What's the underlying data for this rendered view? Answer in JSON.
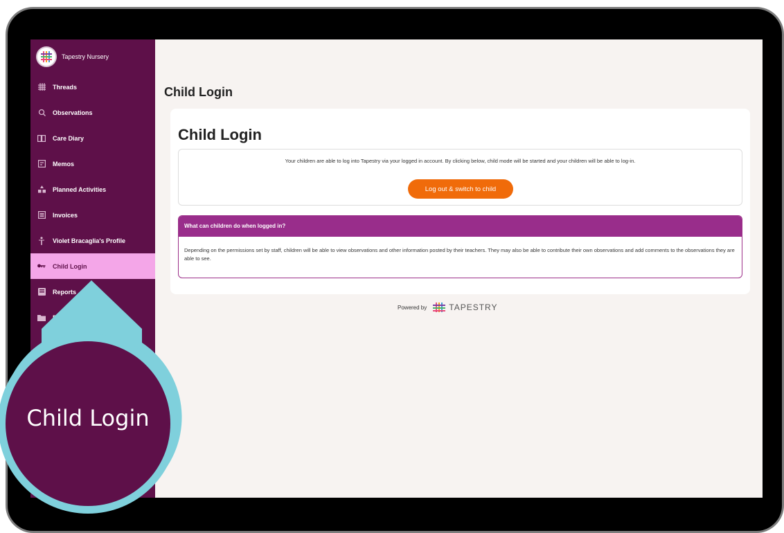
{
  "org": {
    "name": "Tapestry Nursery",
    "logo_icon": "tapestry-logo-icon"
  },
  "sidebar": {
    "items": [
      {
        "label": "Threads",
        "icon": "threads-icon"
      },
      {
        "label": "Observations",
        "icon": "observations-icon"
      },
      {
        "label": "Care Diary",
        "icon": "care-diary-icon"
      },
      {
        "label": "Memos",
        "icon": "memos-icon"
      },
      {
        "label": "Planned Activities",
        "icon": "planned-activities-icon"
      },
      {
        "label": "Invoices",
        "icon": "invoices-icon"
      },
      {
        "label": "Violet Bracaglia's Profile",
        "icon": "profile-icon"
      },
      {
        "label": "Child Login",
        "icon": "key-icon",
        "active": true
      },
      {
        "label": "Reports",
        "icon": "reports-icon"
      },
      {
        "label": "D",
        "icon": "folder-icon"
      }
    ]
  },
  "page": {
    "title": "Child Login",
    "card_title": "Child Login",
    "info_text": "Your children are able to log into Tapestry via your logged in account. By clicking below, child mode will be started and your children will be able to log-in.",
    "button_label": "Log out & switch to child",
    "faq_title": "What can children do when logged in?",
    "faq_body": "Depending on the permissions set by staff, children will be able to view observations and other information posted by their teachers. They may also be able to contribute their own observations and add comments to the observations they are able to see."
  },
  "footer": {
    "powered_by": "Powered by",
    "brand": "TAPESTRY"
  },
  "callout": {
    "label": "Child Login"
  },
  "colors": {
    "sidebar": "#5e1049",
    "active": "#f4a6e8",
    "button": "#f06b0a",
    "faq_header": "#992d8b",
    "callout_ring": "#7fd0dc"
  }
}
